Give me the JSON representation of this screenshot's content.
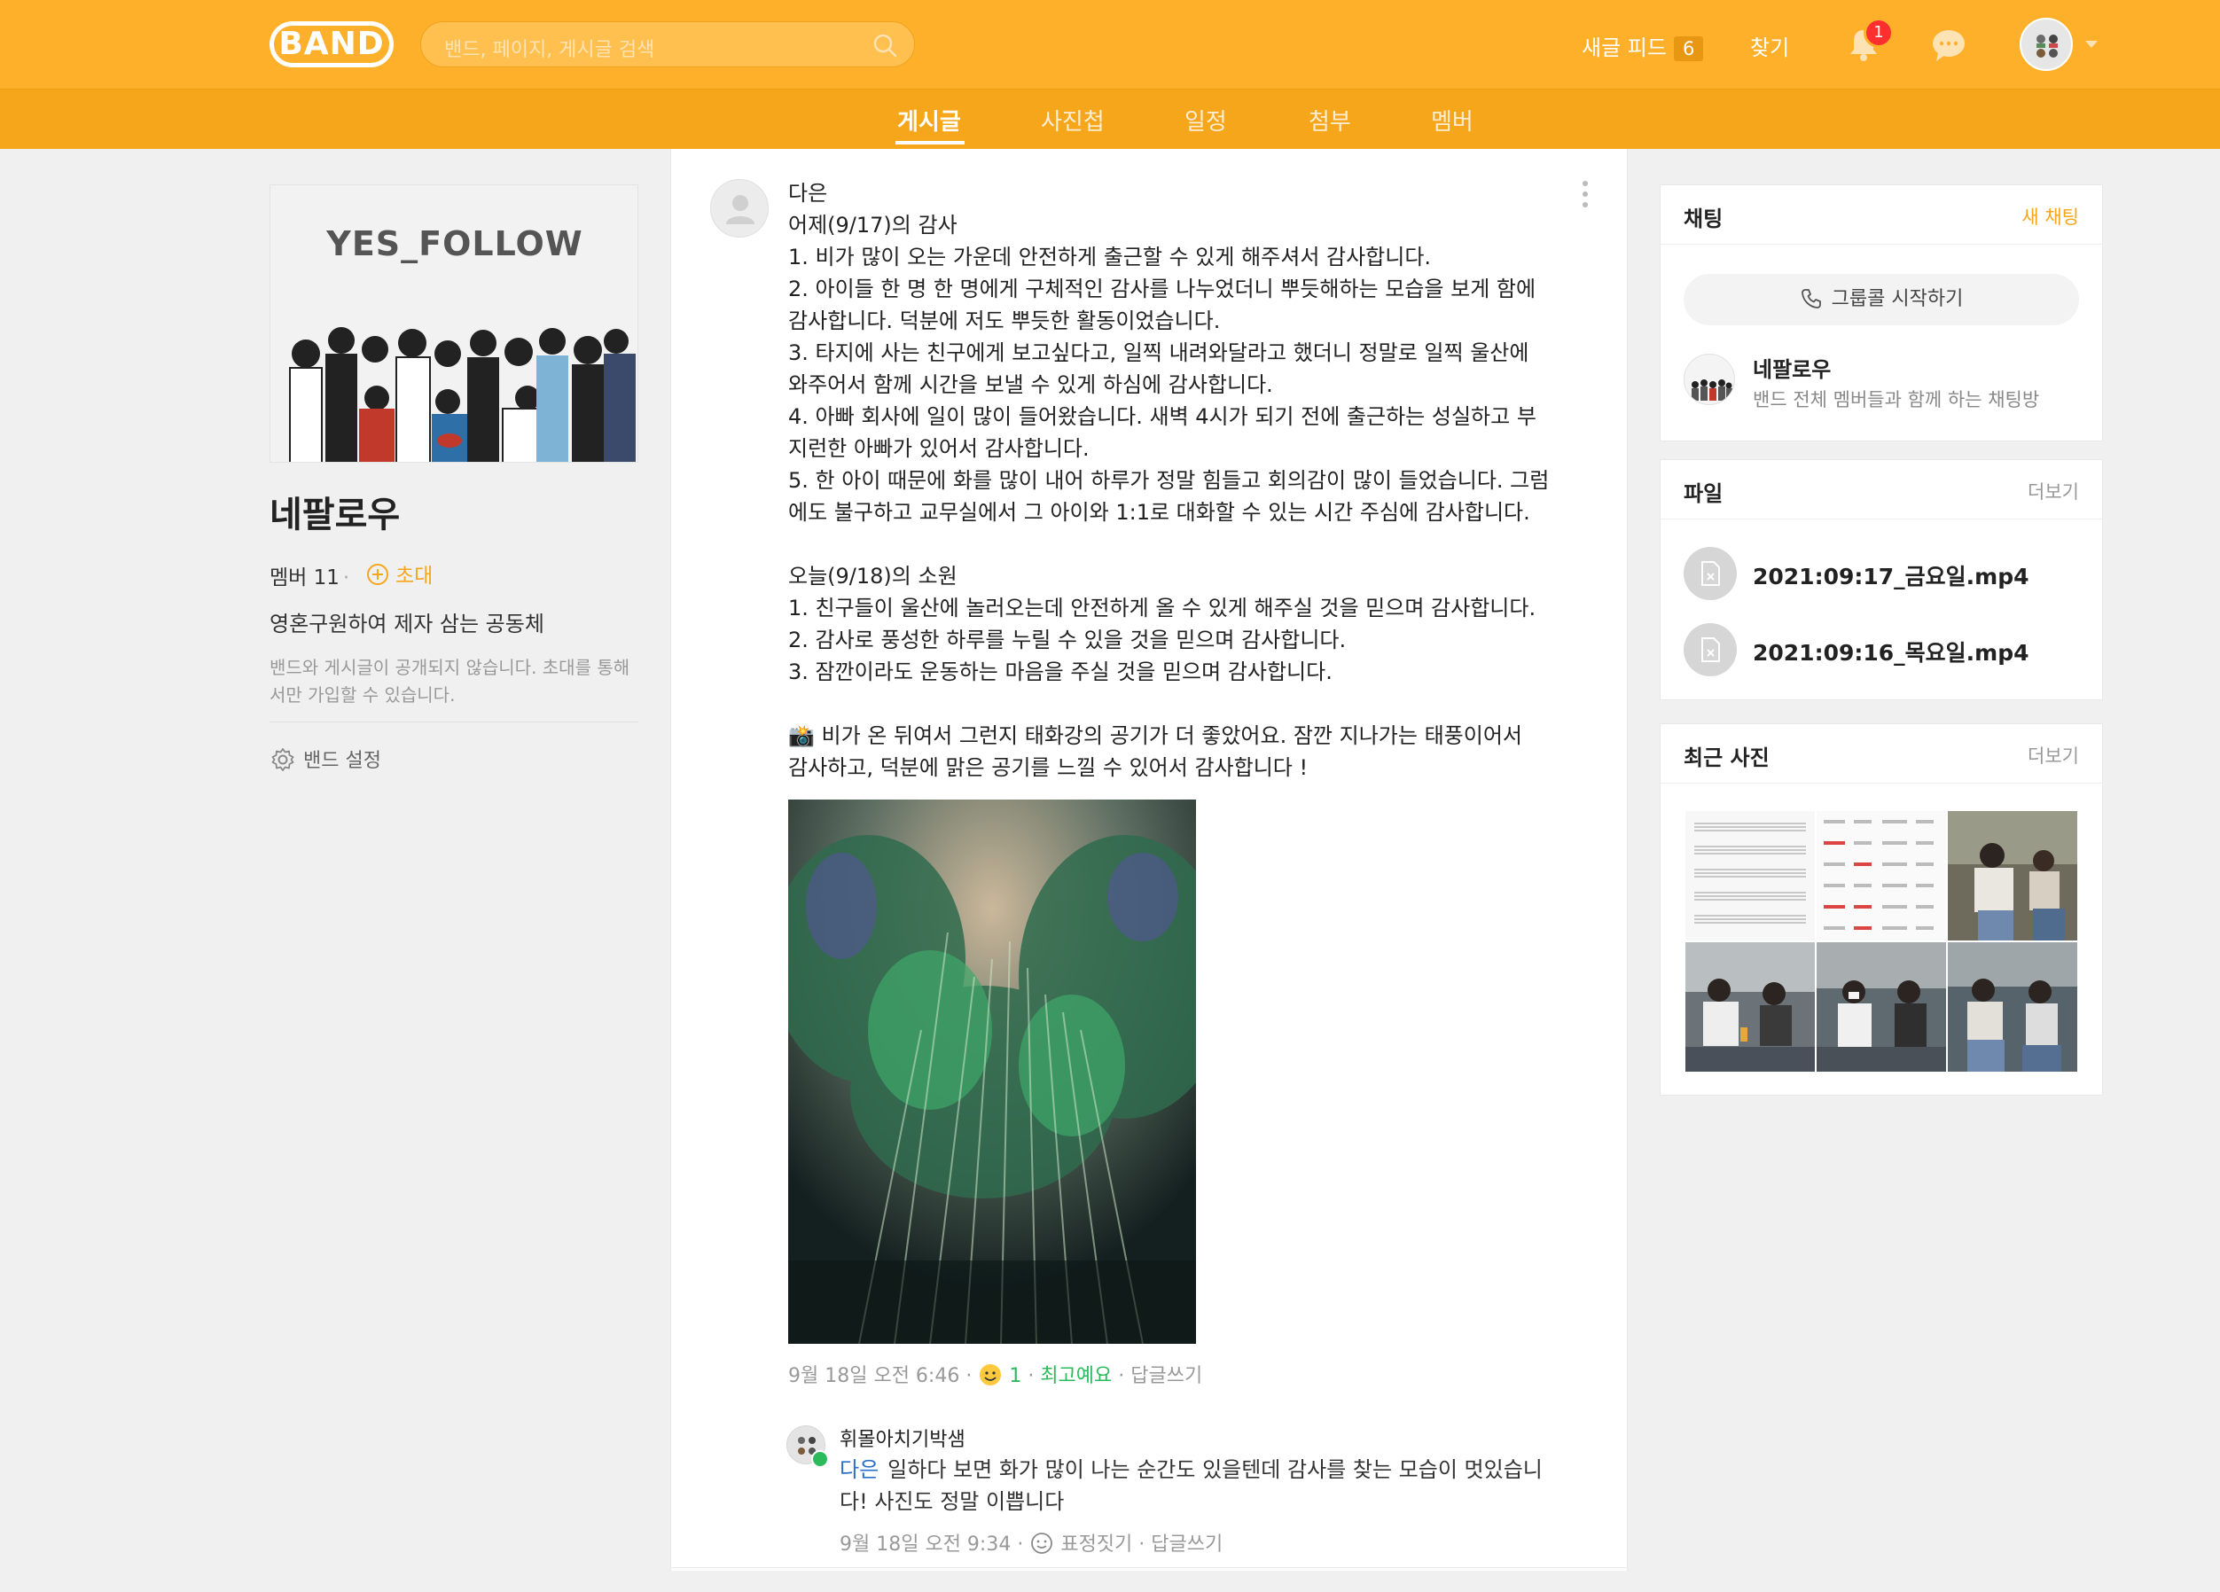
{
  "header": {
    "logo": "BAND",
    "search_placeholder": "밴드, 페이지, 게시글 검색",
    "feed_label": "새글 피드",
    "feed_count": "6",
    "find_label": "찾기",
    "notification_count": "1"
  },
  "nav": {
    "tabs": [
      {
        "label": "게시글",
        "active": true
      },
      {
        "label": "사진첩",
        "active": false
      },
      {
        "label": "일정",
        "active": false
      },
      {
        "label": "첨부",
        "active": false
      },
      {
        "label": "멤버",
        "active": false
      }
    ]
  },
  "band": {
    "cover_text": "YES_FOLLOW",
    "name": "네팔로우",
    "members_label": "멤버 11",
    "invite_label": "초대",
    "description": "영혼구원하여 제자 삼는 공동체",
    "notice": "밴드와 게시글이 공개되지 않습니다. 초대를 통해서만 가입할 수 있습니다.",
    "settings_label": "밴드 설정"
  },
  "post": {
    "author": "다은",
    "lines": [
      "다은",
      "어제(9/17)의 감사",
      "1. 비가 많이 오는 가운데 안전하게 출근할 수 있게 해주셔서 감사합니다.",
      "2. 아이들 한 명 한 명에게 구체적인 감사를 나누었더니 뿌듯해하는 모습을 보게 함에",
      "감사합니다. 덕분에 저도 뿌듯한 활동이었습니다.",
      "3. 타지에 사는 친구에게 보고싶다고, 일찍 내려와달라고 했더니 정말로 일찍 울산에",
      "와주어서 함께 시간을 보낼 수 있게 하심에 감사합니다.",
      "4. 아빠 회사에 일이 많이 들어왔습니다. 새벽 4시가 되기 전에 출근하는 성실하고 부",
      "지런한 아빠가 있어서 감사합니다.",
      "5. 한 아이 때문에 화를 많이 내어 하루가 정말 힘들고 회의감이 많이 들었습니다. 그럼",
      "에도 불구하고 교무실에서 그 아이와 1:1로 대화할 수 있는 시간 주심에 감사합니다.",
      "",
      "오늘(9/18)의 소원",
      "1. 친구들이 울산에 놀러오는데 안전하게 올 수 있게 해주실 것을 믿으며 감사합니다.",
      "2. 감사로 풍성한 하루를 누릴 수 있을 것을 믿으며 감사합니다.",
      "3. 잠깐이라도 운동하는 마음을 주실 것을 믿으며 감사합니다.",
      "",
      "📸 비가 온 뒤여서 그런지 태화강의 공기가 더 좋았어요. 잠깐 지나가는 태풍이어서",
      "감사하고, 덕분에 맑은 공기를 느낄 수 있어서 감사합니다 !"
    ],
    "timestamp": "9월 18일 오전 6:46",
    "reaction_count": "1",
    "reaction_label": "최고예요",
    "reply_label": "답글쓰기"
  },
  "comment": {
    "author": "휘몰아치기박샘",
    "mention": "다은",
    "text": "일하다 보면 화가 많이 나는 순간도 있을텐데 감사를 찾는 모습이 멋있습니다! 사진도 정말 이쁩니다",
    "timestamp": "9월 18일 오전 9:34",
    "react_label": "표정짓기",
    "reply_label": "답글쓰기"
  },
  "chat_card": {
    "title": "채팅",
    "new_chat_label": "새 채팅",
    "group_call_label": "그룹콜 시작하기",
    "room_name": "네팔로우",
    "room_desc": "밴드 전체 멤버들과 함께 하는 채팅방"
  },
  "files_card": {
    "title": "파일",
    "more_label": "더보기",
    "files": [
      "2021:09:17_금요일.mp4",
      "2021:09:16_목요일.mp4"
    ]
  },
  "photos_card": {
    "title": "최근 사진",
    "more_label": "더보기"
  },
  "colors": {
    "brand": "#ffb02a",
    "nav": "#f5a61b",
    "reaction_green": "#2cba5c",
    "mention_blue": "#2a6fc9"
  }
}
